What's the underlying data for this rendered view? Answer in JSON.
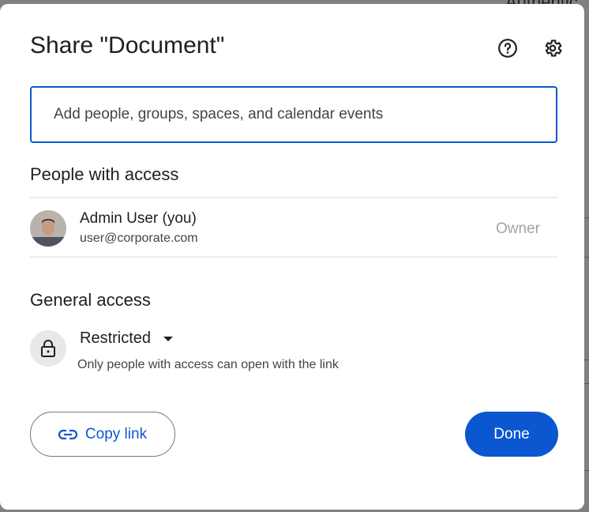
{
  "background": {
    "partial_text": "Authentic"
  },
  "dialog": {
    "title": "Share \"Document\"",
    "help_icon": "help-circle-icon",
    "settings_icon": "gear-icon",
    "search": {
      "placeholder": "Add people, groups, spaces, and calendar events",
      "value": ""
    },
    "people_section": {
      "heading": "People with access",
      "people": [
        {
          "name": "Admin User (you)",
          "email": "user@corporate.com",
          "role": "Owner"
        }
      ]
    },
    "general_access": {
      "heading": "General access",
      "level": "Restricted",
      "description": "Only people with access can open with the link"
    },
    "copy_link_label": "Copy link",
    "done_label": "Done"
  },
  "colors": {
    "accent": "#0b57d0",
    "text": "#1f1f1f",
    "muted": "#a3a3a3"
  }
}
